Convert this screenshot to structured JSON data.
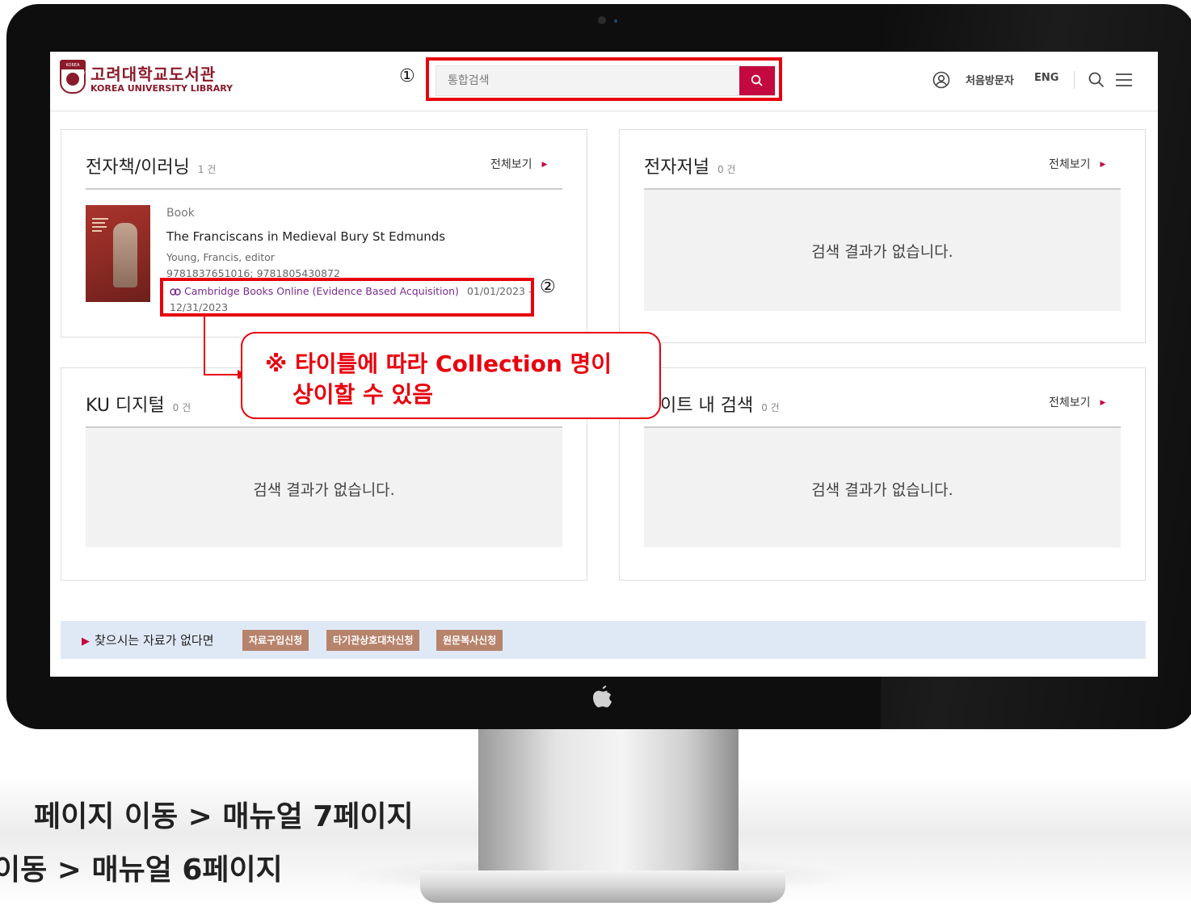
{
  "header": {
    "brand_ko": "고려대학교도서관",
    "brand_en": "KOREA UNIVERSITY LIBRARY",
    "brand_badge": "KOREA UNIVERSITY",
    "marker_1": "①",
    "search_placeholder": "통합검색",
    "first_visit": "처음방문자",
    "lang": "ENG"
  },
  "cards": {
    "ebook": {
      "title": "전자책/이러닝",
      "count": "1 건",
      "more": "전체보기",
      "item": {
        "type": "Book",
        "title": "The Franciscans in Medieval Bury St Edmunds",
        "author": "Young, Francis, editor",
        "isbn": "9781837651016; 9781805430872",
        "collection": "Cambridge Books Online (Evidence Based Acquisition)",
        "date_from": "01/01/2023 -",
        "date_to": "12/31/2023"
      },
      "marker_2": "②"
    },
    "ejournal": {
      "title": "전자저널",
      "count": "0 건",
      "more": "전체보기",
      "empty": "검색 결과가 없습니다."
    },
    "ku_digital": {
      "title": "KU 디지털",
      "count": "0 건",
      "empty": "검색 결과가 없습니다."
    },
    "site_search": {
      "title": "이트 내 검색",
      "count": "0 건",
      "more": "전체보기",
      "empty": "검색 결과가 없습니다."
    }
  },
  "callout": {
    "line1": "※ 타이틀에 따라 Collection 명이",
    "line2": "상이할 수 있음"
  },
  "request_bar": {
    "label": "찾으시는 자료가 없다면",
    "buttons": [
      "자료구입신청",
      "타기관상호대차신청",
      "원문복사신청"
    ]
  },
  "bottom": {
    "line1": "페이지 이동 > 매뉴얼 7페이지",
    "line2": "이동 > 매뉴얼 6페이지"
  },
  "colors": {
    "brand": "#8b1a2a",
    "accent": "#c3093f",
    "highlight": "#e8000d",
    "request_button": "#b7836b",
    "request_bar": "#dfe9f6"
  }
}
